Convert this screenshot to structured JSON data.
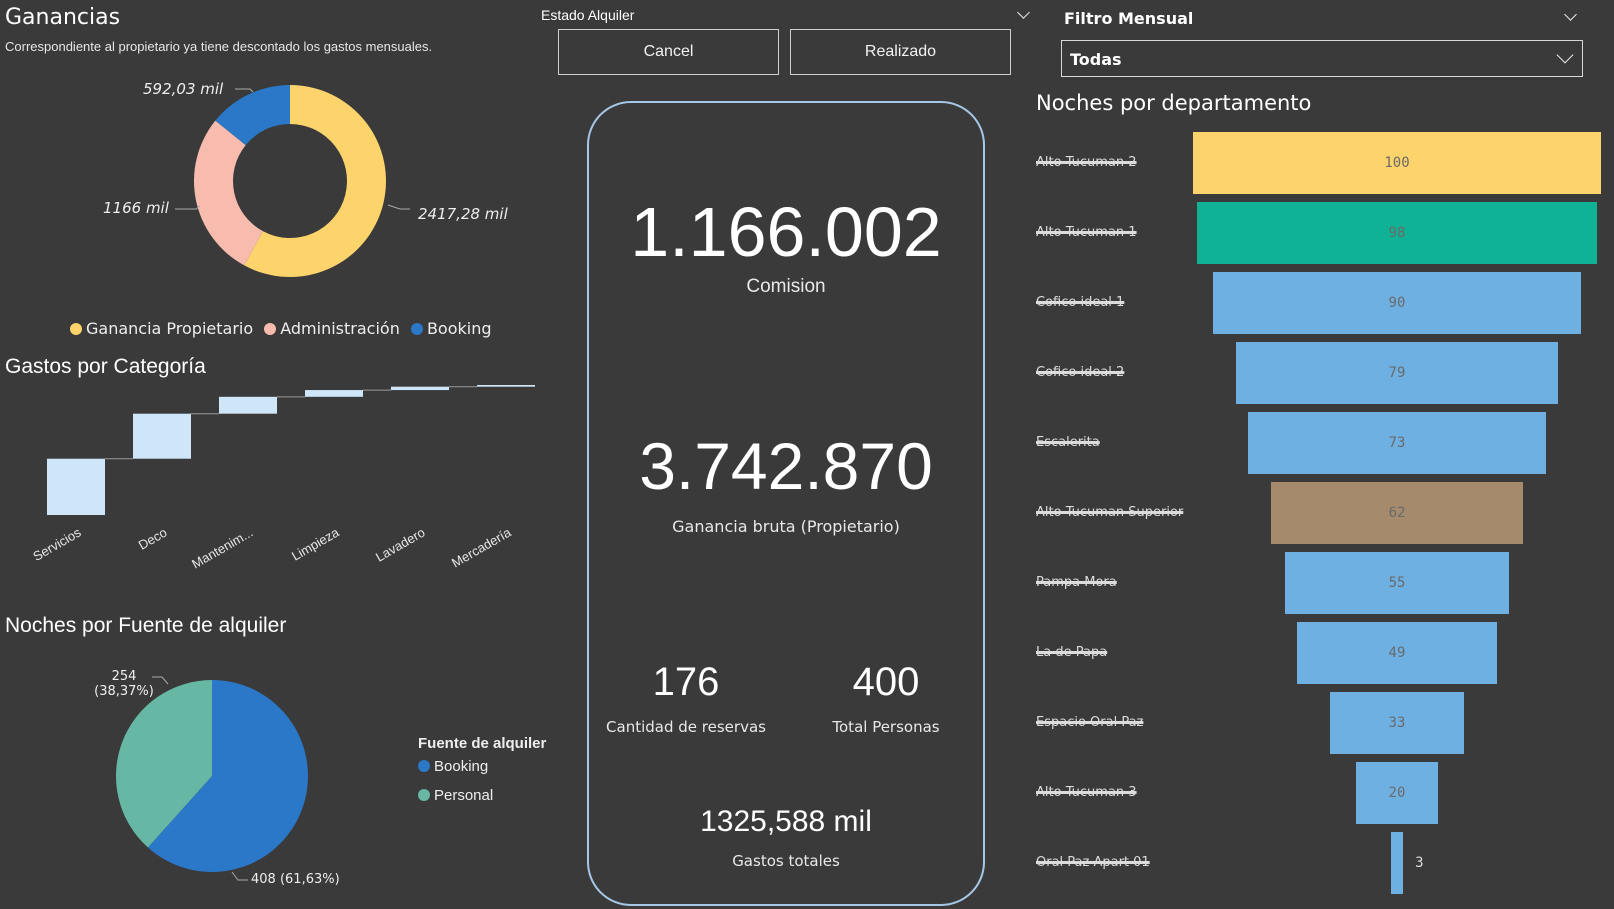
{
  "earnings": {
    "title": "Ganancias",
    "subtitle": "Correspondiente al propietario ya tiene descontado los gastos mensuales.",
    "slices": [
      {
        "name": "Ganancia Propietario",
        "value": 2417.28,
        "label": "2417,28 mil",
        "color": "#fdd36b"
      },
      {
        "name": "Administración",
        "value": 1166,
        "label": "1166 mil",
        "color": "#f7bcae"
      },
      {
        "name": "Booking",
        "value": 592.03,
        "label": "592,03 mil",
        "color": "#2b78c8"
      }
    ]
  },
  "estado_alquiler": {
    "label": "Estado Alquiler",
    "options": [
      "Cancel",
      "Realizado"
    ]
  },
  "filtro_mensual": {
    "label": "Filtro Mensual",
    "selected": "Todas"
  },
  "expenses": {
    "title": "Gastos por Categoría",
    "categories": [
      "Servicios",
      "Deco",
      "Mantenim...",
      "Limpieza",
      "Lavadero",
      "Mercadería"
    ],
    "values": [
      100,
      80,
      30,
      12,
      6,
      3
    ],
    "color": "#cfe6f8"
  },
  "nights_source": {
    "title": "Noches por Fuente de alquiler",
    "legend_title": "Fuente de alquiler",
    "slices": [
      {
        "name": "Booking",
        "value": 408,
        "pct": "(61,63%)",
        "color": "#2b78c8"
      },
      {
        "name": "Personal",
        "value": 254,
        "pct": "(38,37%)",
        "color": "#66b7a3"
      }
    ]
  },
  "kpis": {
    "comision_value": "1.166.002",
    "comision_label": "Comision",
    "ganancia_value": "3.742.870",
    "ganancia_label": "Ganancia bruta (Propietario)",
    "reservas_value": "176",
    "reservas_label": "Cantidad de reservas",
    "personas_value": "400",
    "personas_label": "Total Personas",
    "gastos_value": "1325,588 mil",
    "gastos_label": "Gastos totales"
  },
  "nights_dept": {
    "title": "Noches por departamento",
    "max": 100,
    "rows": [
      {
        "label": "Alto Tucuman 2",
        "value": 100,
        "color": "#fdd36b"
      },
      {
        "label": "Alto Tucuman 1",
        "value": 98,
        "color": "#10b295"
      },
      {
        "label": "Cofico ideal 1",
        "value": 90,
        "color": "#6fb0e2"
      },
      {
        "label": "Cofico ideal 2",
        "value": 79,
        "color": "#6fb0e2"
      },
      {
        "label": "Escalerita",
        "value": 73,
        "color": "#6fb0e2"
      },
      {
        "label": "Alto Tucuman Superior",
        "value": 62,
        "color": "#a68a6c"
      },
      {
        "label": "Pampa Mora",
        "value": 55,
        "color": "#6fb0e2"
      },
      {
        "label": "La de Papa",
        "value": 49,
        "color": "#6fb0e2"
      },
      {
        "label": "Espacio Oral Paz",
        "value": 33,
        "color": "#6fb0e2"
      },
      {
        "label": "Alto Tucuman 3",
        "value": 20,
        "color": "#6fb0e2"
      },
      {
        "label": "Oral Paz Apart 01",
        "value": 3,
        "color": "#6fb0e2"
      }
    ]
  }
}
